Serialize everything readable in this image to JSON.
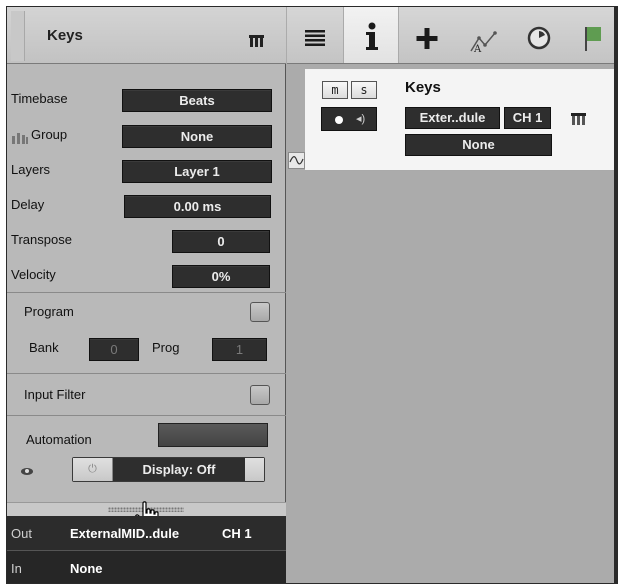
{
  "inspector": {
    "title": "Keys",
    "rows": [
      {
        "label": "Timebase",
        "value": "Beats"
      },
      {
        "label": "Group",
        "value": "None"
      },
      {
        "label": "Layers",
        "value": "Layer 1"
      },
      {
        "label": "Delay",
        "value": "0.00 ms"
      },
      {
        "label": "Transpose",
        "value": "0"
      },
      {
        "label": "Velocity",
        "value": "0%"
      }
    ],
    "program": {
      "label": "Program",
      "bank_label": "Bank",
      "bank_value": "0",
      "prog_label": "Prog",
      "prog_value": "1"
    },
    "input_filter": {
      "label": "Input Filter"
    },
    "automation": {
      "label": "Automation",
      "display_label": "Display: Off"
    },
    "output": {
      "out_label": "Out",
      "out_device": "ExternalMID..dule",
      "out_channel": "CH 1",
      "in_label": "In",
      "in_value": "None"
    }
  },
  "toolbar": {
    "buttons": [
      "list-icon",
      "info-icon",
      "add-icon",
      "automation-icon",
      "clock-icon",
      "flag-icon"
    ]
  },
  "track": {
    "mute_label": "m",
    "solo_label": "s",
    "name": "Keys",
    "device": "Exter..dule",
    "channel": "CH 1",
    "input": "None"
  },
  "colors": {
    "panel_bg": "#b9b9b9",
    "field_bg": "#2e2e2e",
    "field_text": "#ececec",
    "track_bg": "#f4f4f4",
    "arrange_bg": "#ababab",
    "flag_green": "#5f9c51"
  }
}
